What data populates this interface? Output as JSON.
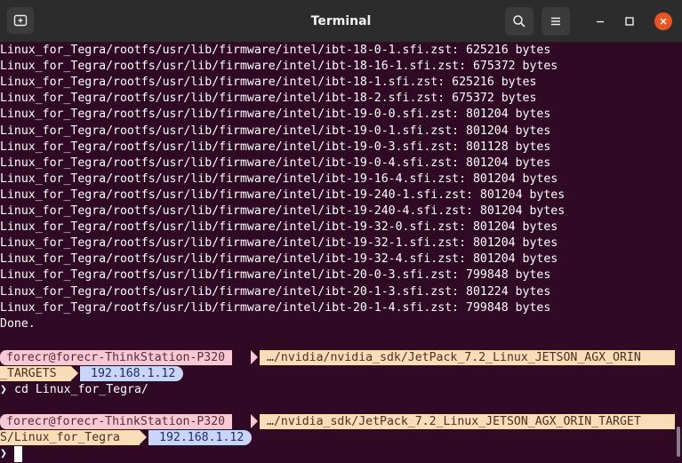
{
  "window": {
    "title": "Terminal"
  },
  "colors": {
    "background": "#300a24",
    "titlebar": "#2c2c2c",
    "close_button": "#e95420",
    "segment_user": "#f7c9d4",
    "segment_path": "#f9dcb8",
    "segment_ip": "#c9d6fa"
  },
  "titlebar": {
    "new_tab_icon": "new-tab-icon",
    "search_icon": "search-icon",
    "menu_icon": "hamburger-menu-icon",
    "minimize_icon": "minimize-icon",
    "maximize_icon": "maximize-icon",
    "close_icon": "close-icon"
  },
  "output_lines": [
    "Linux_for_Tegra/rootfs/usr/lib/firmware/intel/ibt-18-0-1.sfi.zst: 625216 bytes",
    "Linux_for_Tegra/rootfs/usr/lib/firmware/intel/ibt-18-16-1.sfi.zst: 675372 bytes",
    "Linux_for_Tegra/rootfs/usr/lib/firmware/intel/ibt-18-1.sfi.zst: 625216 bytes",
    "Linux_for_Tegra/rootfs/usr/lib/firmware/intel/ibt-18-2.sfi.zst: 675372 bytes",
    "Linux_for_Tegra/rootfs/usr/lib/firmware/intel/ibt-19-0-0.sfi.zst: 801204 bytes",
    "Linux_for_Tegra/rootfs/usr/lib/firmware/intel/ibt-19-0-1.sfi.zst: 801204 bytes",
    "Linux_for_Tegra/rootfs/usr/lib/firmware/intel/ibt-19-0-3.sfi.zst: 801128 bytes",
    "Linux_for_Tegra/rootfs/usr/lib/firmware/intel/ibt-19-0-4.sfi.zst: 801204 bytes",
    "Linux_for_Tegra/rootfs/usr/lib/firmware/intel/ibt-19-16-4.sfi.zst: 801204 bytes",
    "Linux_for_Tegra/rootfs/usr/lib/firmware/intel/ibt-19-240-1.sfi.zst: 801204 bytes",
    "Linux_for_Tegra/rootfs/usr/lib/firmware/intel/ibt-19-240-4.sfi.zst: 801204 bytes",
    "Linux_for_Tegra/rootfs/usr/lib/firmware/intel/ibt-19-32-0.sfi.zst: 801204 bytes",
    "Linux_for_Tegra/rootfs/usr/lib/firmware/intel/ibt-19-32-1.sfi.zst: 801204 bytes",
    "Linux_for_Tegra/rootfs/usr/lib/firmware/intel/ibt-19-32-4.sfi.zst: 801204 bytes",
    "Linux_for_Tegra/rootfs/usr/lib/firmware/intel/ibt-20-0-3.sfi.zst: 799848 bytes",
    "Linux_for_Tegra/rootfs/usr/lib/firmware/intel/ibt-20-1-3.sfi.zst: 801224 bytes",
    "Linux_for_Tegra/rootfs/usr/lib/firmware/intel/ibt-20-1-4.sfi.zst: 799848 bytes",
    "Done."
  ],
  "prompt1": {
    "user_host": "forecr@forecr-ThinkStation-P320",
    "path_line1": "…/nvidia/nvidia_sdk/JetPack_7.2_Linux_JETSON_AGX_ORIN",
    "path_line2": "_TARGETS",
    "ip": "192.168.1.12",
    "prompt_char": "❯",
    "command": "cd Linux_for_Tegra/"
  },
  "prompt2": {
    "user_host": "forecr@forecr-ThinkStation-P320",
    "path_line1": "…/nvidia_sdk/JetPack_7.2_Linux_JETSON_AGX_ORIN_TARGET",
    "path_line2": "S/Linux_for_Tegra",
    "ip": "192.168.1.12",
    "prompt_char": "❯",
    "command": ""
  }
}
